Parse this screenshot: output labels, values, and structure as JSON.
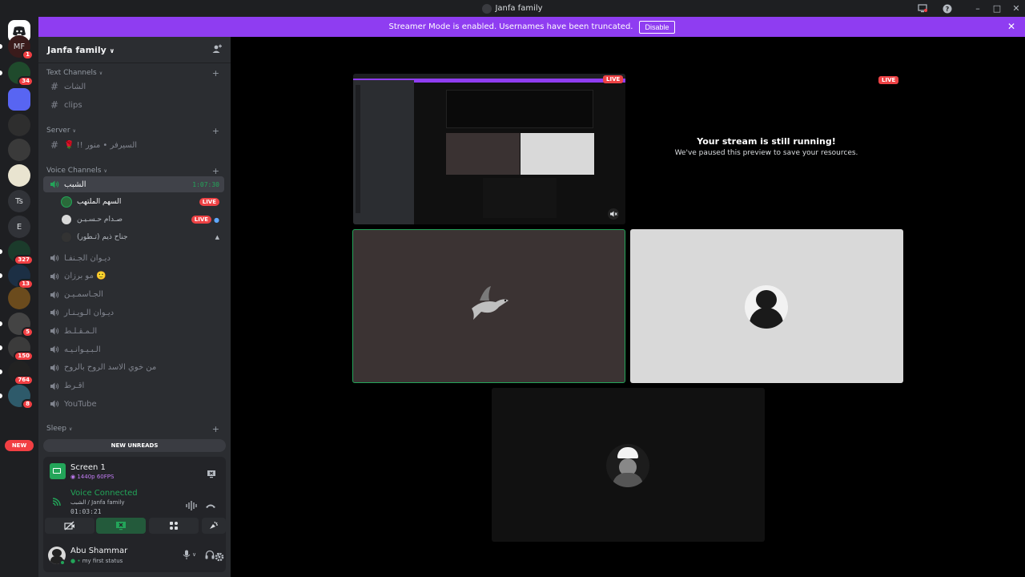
{
  "window": {
    "title": "Janfa family",
    "controls": [
      "monitor-icon",
      "help-icon",
      "minimize-icon",
      "maximize-icon",
      "close-icon"
    ]
  },
  "banner": {
    "text": "Streamer Mode is enabled. Usernames have been truncated.",
    "disable_label": "Disable",
    "color": "#8f3df1"
  },
  "guilds": {
    "items": [
      {
        "label": "MF",
        "badge": "1"
      },
      {
        "label": "",
        "badge": "34"
      },
      {
        "label": "",
        "badge": ""
      },
      {
        "label": "",
        "badge": ""
      },
      {
        "label": "",
        "badge": ""
      },
      {
        "label": "",
        "badge": ""
      },
      {
        "label": "Ts",
        "badge": ""
      },
      {
        "label": "E",
        "badge": ""
      },
      {
        "label": "",
        "badge": "327"
      },
      {
        "label": "",
        "badge": "13"
      },
      {
        "label": "",
        "badge": ""
      },
      {
        "label": "",
        "badge": "5"
      },
      {
        "label": "",
        "badge": "150"
      },
      {
        "label": "",
        "badge": "764"
      },
      {
        "label": "",
        "badge": "8"
      }
    ],
    "new_label": "NEW"
  },
  "sidebar": {
    "server_name": "Janfa family",
    "text_category": "Text Channels",
    "text_channels": [
      "الشات",
      "clips"
    ],
    "server_category": "Server",
    "server_channels": [
      "🌹 !! السيرفر • منور"
    ],
    "voice_category": "Voice Channels",
    "active_channel": {
      "name": "الشبب",
      "timer": "1:07:30"
    },
    "voice_users": [
      {
        "name": "السهم الملتهب",
        "live": "LIVE"
      },
      {
        "name": "صـدام حـسـيـن",
        "live": "LIVE"
      },
      {
        "name": "جناح ذيم (تـطور)",
        "live": ""
      }
    ],
    "voice_channels": [
      "ديـوان الجـنفـا",
      "مو برزان 🙂",
      "الجـاسمـيـن",
      "ديـوان الـويـنـار",
      "الـمـقـلـط",
      "الـبـيـوانـيـه",
      "من خوي الاسد الروح بالروح",
      "اقـرط",
      "YouTube"
    ],
    "sleep_category": "Sleep",
    "new_unreads": "NEW UNREADS"
  },
  "panel": {
    "screen_title": "Screen 1",
    "screen_quality": "1440p 60FPS",
    "voice_status": "Voice Connected",
    "voice_location": "الشبب / Janfa family",
    "voice_timer": "01:03:21",
    "user_name": "Abu Shammar",
    "user_status": "my first status"
  },
  "stage": {
    "preview_title": "Your stream is still running!",
    "preview_subtitle": "We've paused this preview to save your resources.",
    "live_label": "LIVE"
  },
  "colors": {
    "accent": "#5865f2",
    "green": "#23a559",
    "red": "#ed4245"
  }
}
